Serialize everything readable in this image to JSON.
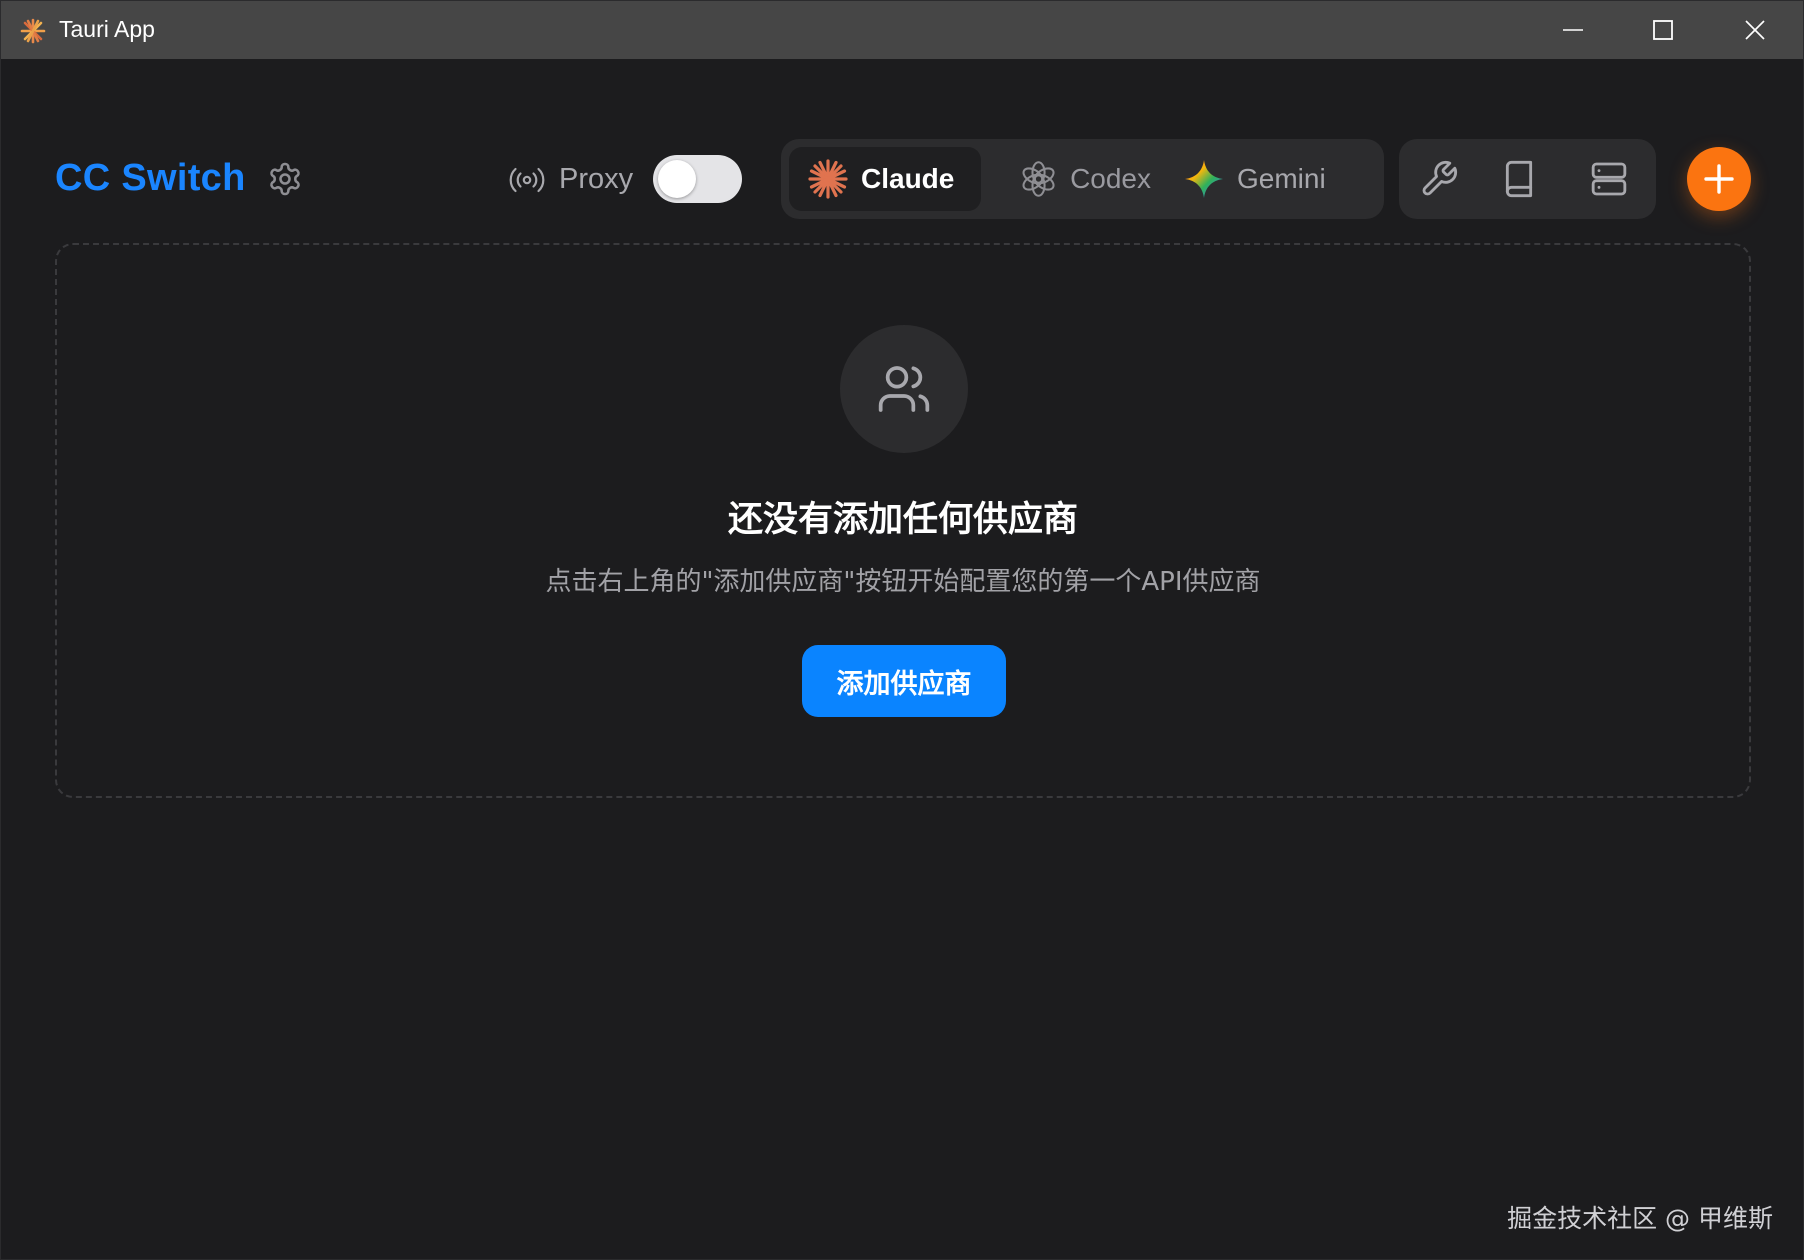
{
  "window": {
    "title": "Tauri App"
  },
  "header": {
    "brand": "CC Switch",
    "proxy_label": "Proxy",
    "proxy_enabled": false,
    "tabs": [
      {
        "label": "Claude",
        "active": true,
        "icon": "claude-spark-icon"
      },
      {
        "label": "Codex",
        "active": false,
        "icon": "openai-knot-icon"
      },
      {
        "label": "Gemini",
        "active": false,
        "icon": "gemini-star-icon"
      }
    ],
    "tools": [
      "wrench-icon",
      "book-icon",
      "server-icon"
    ],
    "add_icon": "plus-icon"
  },
  "empty_state": {
    "icon": "users-icon",
    "title": "还没有添加任何供应商",
    "description": "点击右上角的\"添加供应商\"按钮开始配置您的第一个API供应商",
    "button_label": "添加供应商"
  },
  "watermark": "掘金技术社区 @ 甲维斯",
  "colors": {
    "brand": "#1a85ff",
    "primary_button": "#0a84ff",
    "fab": "#fb7410",
    "background": "#1c1c1e",
    "titlebar": "#464646",
    "claude": "#e0734f"
  }
}
